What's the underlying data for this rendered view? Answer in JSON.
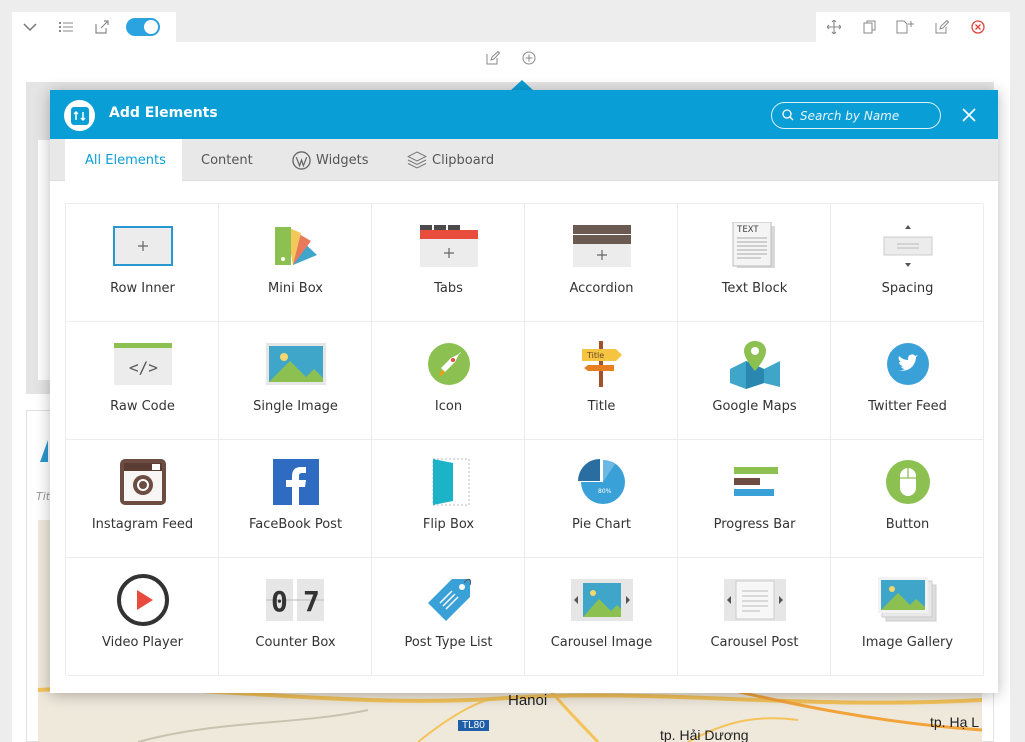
{
  "modal": {
    "title": "Add Elements",
    "search_placeholder": "Search by Name"
  },
  "tabs": [
    {
      "label": "All Elements",
      "active": true
    },
    {
      "label": "Content",
      "active": false
    },
    {
      "label": "Widgets",
      "active": false
    },
    {
      "label": "Clipboard",
      "active": false
    }
  ],
  "elements": [
    {
      "label": "Row Inner",
      "icon": "row-inner-icon"
    },
    {
      "label": "Mini Box",
      "icon": "mini-box-icon"
    },
    {
      "label": "Tabs",
      "icon": "tabs-icon"
    },
    {
      "label": "Accordion",
      "icon": "accordion-icon"
    },
    {
      "label": "Text Block",
      "icon": "text-block-icon"
    },
    {
      "label": "Spacing",
      "icon": "spacing-icon"
    },
    {
      "label": "Raw Code",
      "icon": "raw-code-icon"
    },
    {
      "label": "Single Image",
      "icon": "single-image-icon"
    },
    {
      "label": "Icon",
      "icon": "rocket-icon"
    },
    {
      "label": "Title",
      "icon": "title-signpost-icon"
    },
    {
      "label": "Google Maps",
      "icon": "google-maps-icon"
    },
    {
      "label": "Twitter Feed",
      "icon": "twitter-icon"
    },
    {
      "label": "Instagram Feed",
      "icon": "instagram-icon"
    },
    {
      "label": "FaceBook Post",
      "icon": "facebook-icon"
    },
    {
      "label": "Flip Box",
      "icon": "flip-box-icon"
    },
    {
      "label": "Pie Chart",
      "icon": "pie-chart-icon"
    },
    {
      "label": "Progress Bar",
      "icon": "progress-bar-icon"
    },
    {
      "label": "Button",
      "icon": "mouse-button-icon"
    },
    {
      "label": "Video Player",
      "icon": "video-player-icon"
    },
    {
      "label": "Counter Box",
      "icon": "counter-box-icon"
    },
    {
      "label": "Post Type List",
      "icon": "price-tag-icon"
    },
    {
      "label": "Carousel Image",
      "icon": "carousel-image-icon"
    },
    {
      "label": "Carousel Post",
      "icon": "carousel-post-icon"
    },
    {
      "label": "Image Gallery",
      "icon": "image-gallery-icon"
    }
  ],
  "icon_text": {
    "text_block": "TEXT",
    "title_sign": "Title",
    "pie_percent": "80%",
    "counter_0": "0",
    "counter_7": "7"
  },
  "map": {
    "city": "Hanoi",
    "road": "TL80",
    "town1": "tp. Hải Dương",
    "town2": "tp. Hạ L"
  },
  "background": {
    "italic_text": "Tit"
  },
  "colors": {
    "header": "#0a9ed6",
    "active_tab": "#0a9ed6",
    "toggle": "#2aa3e0",
    "close_red": "#e0443a"
  }
}
